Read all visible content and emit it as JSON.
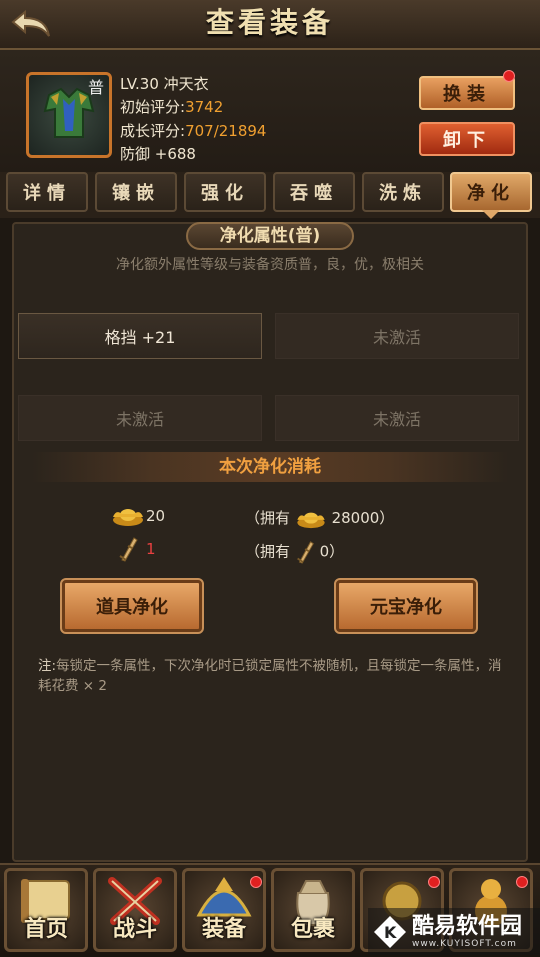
{
  "header": {
    "title": "查看装备"
  },
  "item": {
    "grade": "普",
    "level_name": "LV.30 冲天衣",
    "initial_score_label": "初始评分:",
    "initial_score": "3742",
    "growth_score_label": "成长评分:",
    "growth_score": "707/21894",
    "defense": "防御 +688"
  },
  "buttons": {
    "change": "换装",
    "remove": "卸下"
  },
  "tabs": [
    {
      "label": "详情"
    },
    {
      "label": "镶嵌"
    },
    {
      "label": "强化"
    },
    {
      "label": "吞噬"
    },
    {
      "label": "洗炼"
    },
    {
      "label": "净化"
    }
  ],
  "section": {
    "title": "净化属性(普)",
    "desc": "净化额外属性等级与装备资质普，良，优，极相关"
  },
  "attrs": [
    "格挡 +21",
    "未激活",
    "未激活",
    "未激活"
  ],
  "cost": {
    "title": "本次净化消耗",
    "gold_cost": "20",
    "gold_owned_label": "（拥有",
    "gold_owned": "28000）",
    "item_cost": "1",
    "item_owned_label": "（拥有",
    "item_owned": "0）"
  },
  "actions": {
    "item_purify": "道具净化",
    "gold_purify": "元宝净化"
  },
  "note": {
    "prefix": "注:",
    "text": "每锁定一条属性，下次净化时已锁定属性不被随机，且每锁定一条属性，消耗花费 × 2"
  },
  "nav": [
    "首页",
    "战斗",
    "装备",
    "包裹"
  ],
  "watermark": {
    "name": "酷易软件园",
    "url": "www.KUYISOFT.com"
  },
  "colors": {
    "accent": "#f0a030",
    "active_tab": "#e0a868",
    "alert_dot": "#e02020"
  }
}
